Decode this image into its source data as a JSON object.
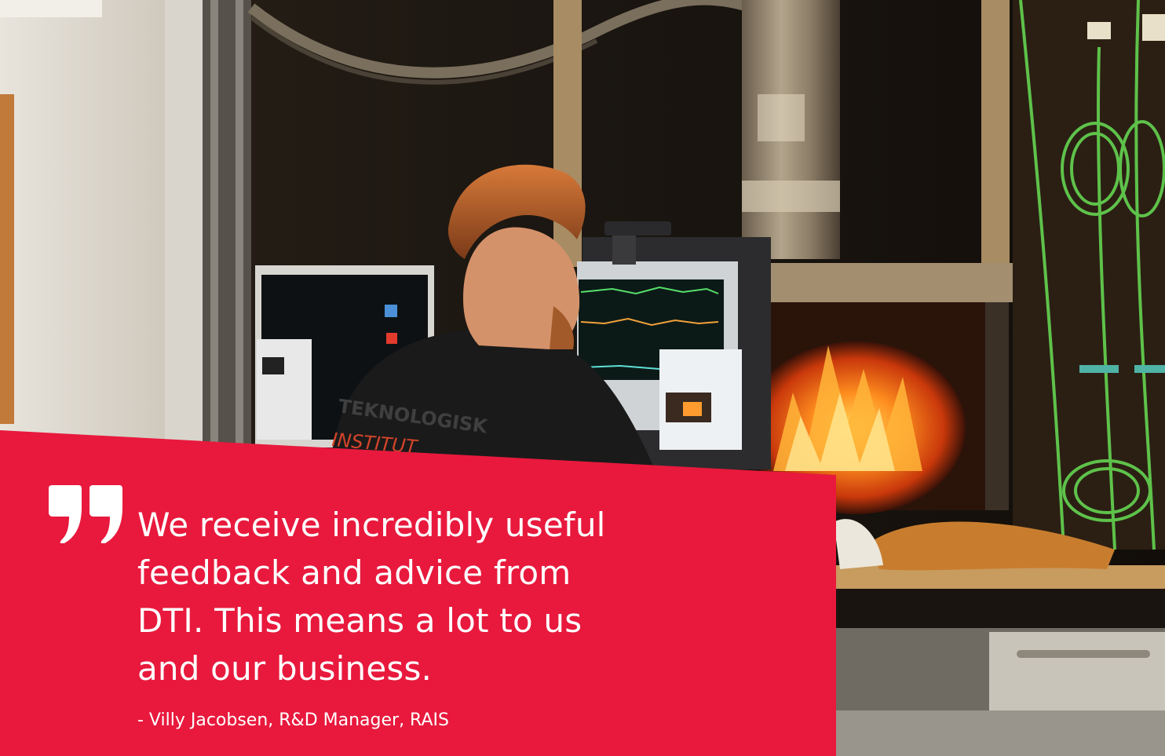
{
  "quote": {
    "lines": [
      "We receive incredibly useful",
      "feedback and advice from",
      "DTI. This means a lot to us",
      "and our business."
    ],
    "attribution": "- Villy Jacobsen, R&D Manager, RAIS"
  },
  "photo": {
    "shirt_text_top": "TEKNOLOGISK",
    "shirt_text_bottom": "INSTITUT"
  },
  "colors": {
    "accent_red": "#E8193D",
    "quote_text": "#FFFFFF"
  },
  "icons": {
    "quote_mark": "closing-quote-icon"
  }
}
